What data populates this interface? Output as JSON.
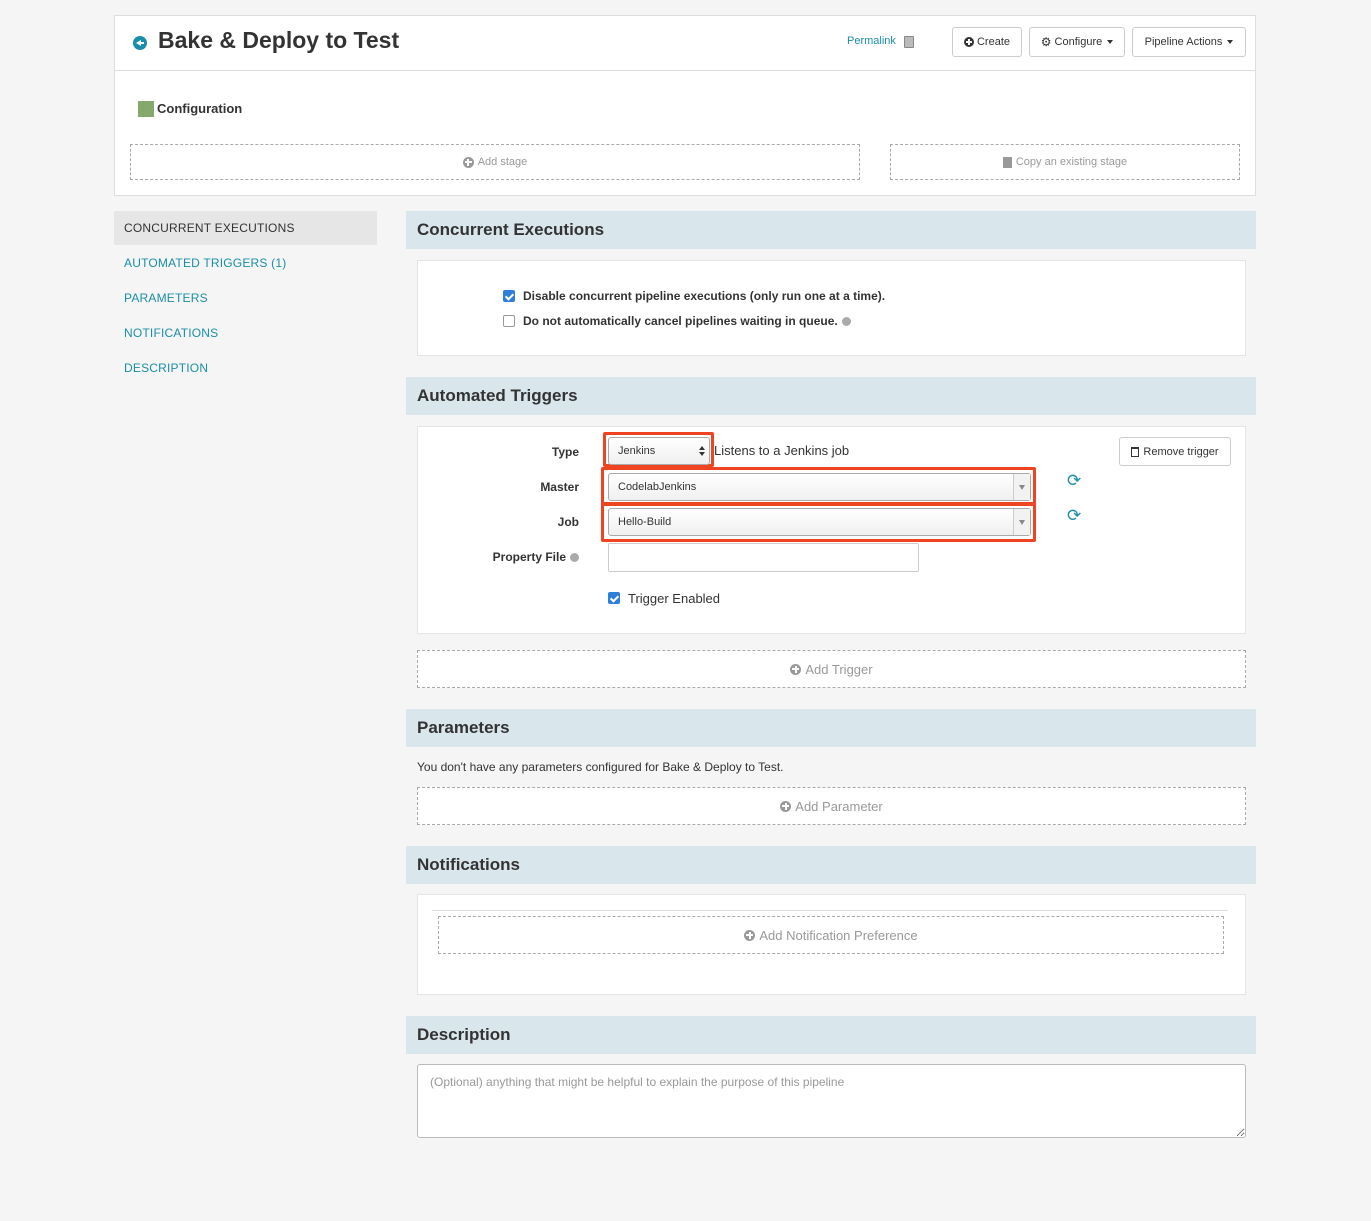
{
  "header": {
    "title": "Bake & Deploy to Test",
    "permalink": "Permalink",
    "create_label": "Create",
    "configure_label": "Configure",
    "actions_label": "Pipeline Actions"
  },
  "config": {
    "label": "Configuration",
    "add_stage": "Add stage",
    "copy_stage": "Copy an existing stage"
  },
  "nav": {
    "items": [
      {
        "label": "CONCURRENT EXECUTIONS"
      },
      {
        "label": "AUTOMATED TRIGGERS (1)"
      },
      {
        "label": "PARAMETERS"
      },
      {
        "label": "NOTIFICATIONS"
      },
      {
        "label": "DESCRIPTION"
      }
    ]
  },
  "concurrent": {
    "title": "Concurrent Executions",
    "disable_label": "Disable concurrent pipeline executions (only run one at a time).",
    "disable_checked": true,
    "no_cancel_label": "Do not automatically cancel pipelines waiting in queue.",
    "no_cancel_checked": false
  },
  "triggers": {
    "title": "Automated Triggers",
    "type_label": "Type",
    "type_value": "Jenkins",
    "type_desc": "Listens to a Jenkins job",
    "master_label": "Master",
    "master_value": "CodelabJenkins",
    "job_label": "Job",
    "job_value": "Hello-Build",
    "property_file_label": "Property File",
    "property_file_value": "",
    "enabled_label": "Trigger Enabled",
    "enabled_checked": true,
    "remove_label": "Remove trigger",
    "add_label": "Add Trigger",
    "highlight_color": "#ee4422"
  },
  "parameters": {
    "title": "Parameters",
    "empty_text": "You don't have any parameters configured for Bake & Deploy to Test.",
    "add_label": "Add Parameter"
  },
  "notifications": {
    "title": "Notifications",
    "add_label": "Add Notification Preference"
  },
  "description": {
    "title": "Description",
    "placeholder": "(Optional) anything that might be helpful to explain the purpose of this pipeline"
  },
  "colors": {
    "accent": "#1a8ea8",
    "section_header": "#d9e6ec",
    "config_swatch": "#86a86a",
    "checkbox": "#2f7fd9"
  }
}
